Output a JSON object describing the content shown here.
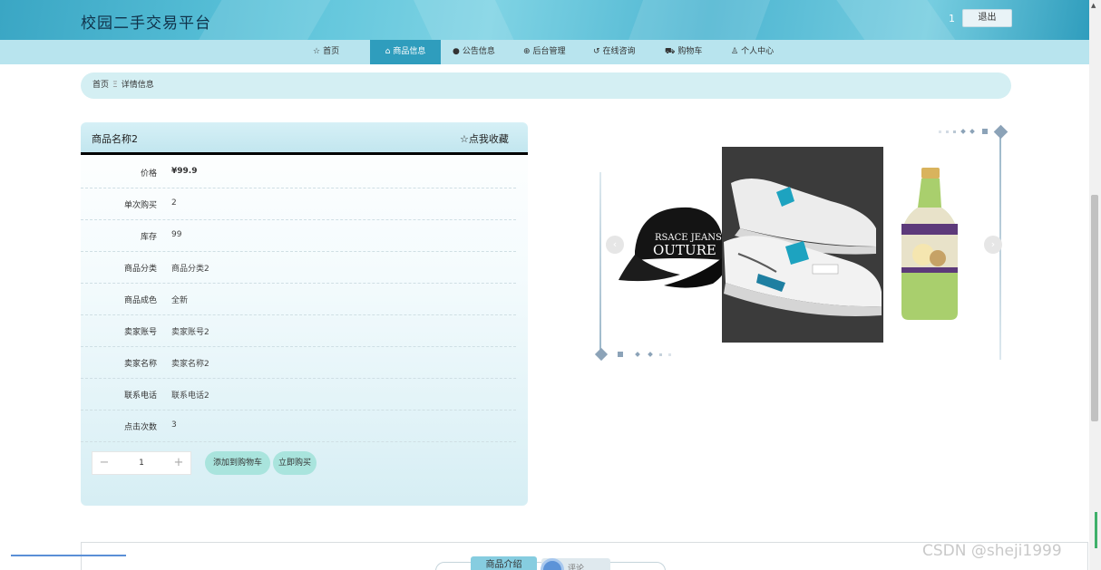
{
  "header": {
    "site_title": "校园二手交易平台",
    "user_name": "1",
    "logout_label": "退出"
  },
  "nav": {
    "items": [
      {
        "icon": "☆",
        "label": "首页",
        "active": false
      },
      {
        "icon": "⌂",
        "label": "商品信息",
        "active": true
      },
      {
        "icon": "●",
        "label": "公告信息",
        "active": false
      },
      {
        "icon": "⊕",
        "label": "后台管理",
        "active": false
      },
      {
        "icon": "↺",
        "label": "在线咨询",
        "active": false
      },
      {
        "icon": "⛟",
        "label": "购物车",
        "active": false
      },
      {
        "icon": "♙",
        "label": "个人中心",
        "active": false
      }
    ]
  },
  "breadcrumb": {
    "home": "首页",
    "separator": "Ξ",
    "current": "详情信息"
  },
  "detail": {
    "title": "商品名称2",
    "favorite_label": "☆点我收藏",
    "rows": [
      {
        "label": "价格",
        "value": "¥99.9"
      },
      {
        "label": "单次购买",
        "value": "2"
      },
      {
        "label": "库存",
        "value": "99"
      },
      {
        "label": "商品分类",
        "value": "商品分类2"
      },
      {
        "label": "商品成色",
        "value": "全新"
      },
      {
        "label": "卖家账号",
        "value": "卖家账号2"
      },
      {
        "label": "卖家名称",
        "value": "卖家名称2"
      },
      {
        "label": "联系电话",
        "value": "联系电话2"
      },
      {
        "label": "点击次数",
        "value": "3"
      }
    ],
    "quantity": "1",
    "minus_label": "−",
    "plus_label": "+",
    "add_to_cart_label": "添加到购物车",
    "buy_now_label": "立即购买"
  },
  "carousel": {
    "prev_icon": "‹",
    "next_icon": "›",
    "cap_text_line1": "RSACE JEANS",
    "cap_text_line2": "OUTURE"
  },
  "bottom": {
    "tab_label": "商品介绍",
    "tab2_label": "评论"
  },
  "watermark": "CSDN @sheji1999",
  "colors": {
    "accent": "#2f9dbd",
    "nav_bg": "#b8e4ee",
    "breadcrumb_bg": "#d4eff3",
    "button_bg": "#a9e4dd"
  }
}
